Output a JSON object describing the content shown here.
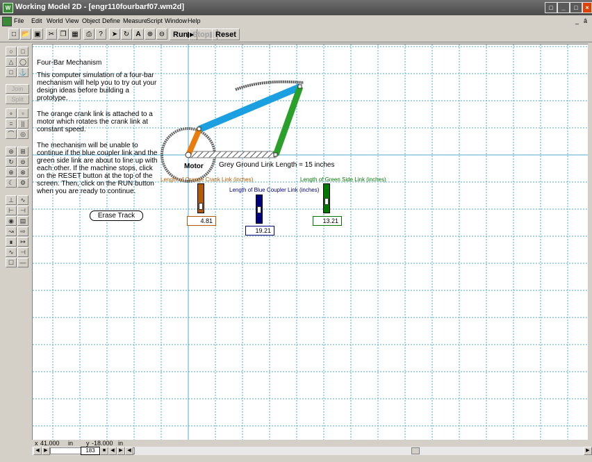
{
  "window": {
    "title": "Working Model 2D - [engr110fourbarf07.wm2d]",
    "app_icon": "working-model-icon",
    "controls": [
      "minimize-icon",
      "maximize-icon",
      "close-icon"
    ]
  },
  "menubar": {
    "items": [
      "File",
      "Edit",
      "World",
      "View",
      "Object",
      "Define",
      "Measure",
      "Script",
      "Window",
      "Help"
    ],
    "mdi_controls": [
      "_",
      "ȃ"
    ]
  },
  "toolbar": {
    "run_label": "Run▶",
    "stop_label": "Stop▮",
    "reset_label": "Reset",
    "icons": [
      "new-icon",
      "open-icon",
      "save-icon",
      "cut-icon",
      "copy-icon",
      "paste-icon",
      "print-icon",
      "help-icon",
      "arrow-tool-icon",
      "rotate-tool-icon",
      "text-tool-icon",
      "zoom-in-icon",
      "zoom-out-icon"
    ]
  },
  "palette": {
    "join_label": "Join",
    "split_label": "Split"
  },
  "canvas": {
    "description_title": "Four-Bar Mechanism",
    "paragraphs": [
      "This computer simulation of a four-bar mechanism will help you to try out your design ideas before building a prototype.",
      "The orange crank link is attached to a motor which  rotates the crank link at constant speed.",
      "The mechanism will be unable to continue if the blue coupler link and the green side link are about to line up with each other.  If the machine stops, click on the RESET button at the top of the screen.  Then, click on the RUN button when you are ready to continue."
    ],
    "erase_track_label": "Erase Track",
    "motor_label": "Motor",
    "ground_label": "Grey Ground Link Length = 15 inches",
    "sliders": [
      {
        "label": "Length of Orange Crank Link (inches)",
        "value": "4.81",
        "color": "#b35a00"
      },
      {
        "label": "Length of Blue Coupler Link (inches)",
        "value": "19.21",
        "color": "#000080"
      },
      {
        "label": "Length of Green Side Link (inches)",
        "value": "13.21",
        "color": "#007800"
      }
    ],
    "colors": {
      "crank": "#e87d0d",
      "coupler": "#1aa0e0",
      "side": "#2aa02a",
      "ground": "#9a9a9a",
      "grid": "#4ea8d0"
    }
  },
  "status": {
    "x_label": "x",
    "x_value": "41.000",
    "x_unit": "in",
    "y_label": "y",
    "y_value": "-18.000",
    "y_unit": "in",
    "frame": "183"
  }
}
